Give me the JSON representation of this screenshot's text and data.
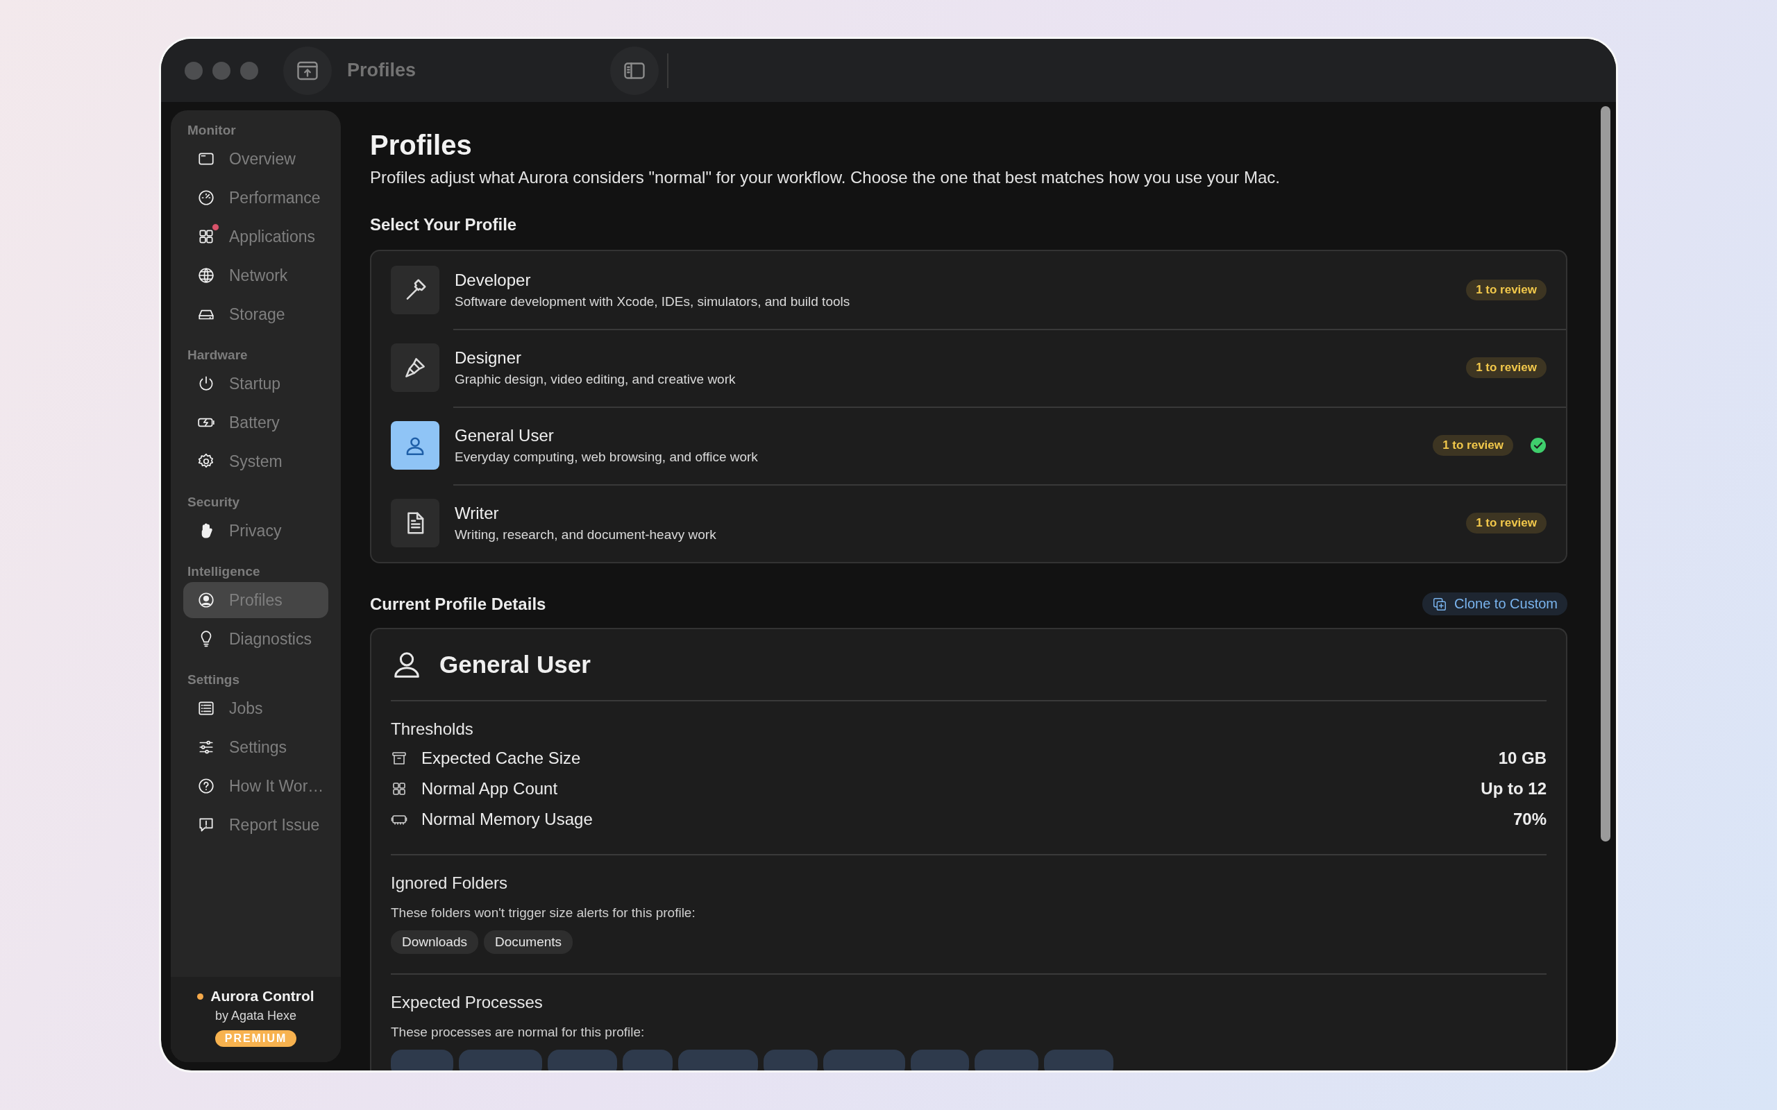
{
  "window": {
    "title": "Profiles"
  },
  "sidebar": {
    "sections": [
      {
        "title": "Monitor",
        "items": [
          {
            "label": "Overview",
            "selected": false,
            "alert": false
          },
          {
            "label": "Performance",
            "selected": false,
            "alert": false
          },
          {
            "label": "Applications",
            "selected": false,
            "alert": true
          },
          {
            "label": "Network",
            "selected": false,
            "alert": false
          },
          {
            "label": "Storage",
            "selected": false,
            "alert": false
          }
        ]
      },
      {
        "title": "Hardware",
        "items": [
          {
            "label": "Startup",
            "selected": false,
            "alert": false
          },
          {
            "label": "Battery",
            "selected": false,
            "alert": false
          },
          {
            "label": "System",
            "selected": false,
            "alert": false
          }
        ]
      },
      {
        "title": "Security",
        "items": [
          {
            "label": "Privacy",
            "selected": false,
            "alert": false
          }
        ]
      },
      {
        "title": "Intelligence",
        "items": [
          {
            "label": "Profiles",
            "selected": true,
            "alert": false
          },
          {
            "label": "Diagnostics",
            "selected": false,
            "alert": false
          }
        ]
      },
      {
        "title": "Settings",
        "items": [
          {
            "label": "Jobs",
            "selected": false,
            "alert": false
          },
          {
            "label": "Settings",
            "selected": false,
            "alert": false
          },
          {
            "label": "How It Wor…",
            "selected": false,
            "alert": false
          },
          {
            "label": "Report Issue",
            "selected": false,
            "alert": false
          }
        ]
      }
    ],
    "footer": {
      "app": "Aurora Control",
      "author": "by Agata Hexe",
      "badge": "PREMIUM"
    }
  },
  "page": {
    "title": "Profiles",
    "description": "Profiles adjust what Aurora considers \"normal\" for your workflow. Choose the one that best matches how you use your Mac."
  },
  "select_heading": "Select Your Profile",
  "profiles": [
    {
      "name": "Developer",
      "description": "Software development with Xcode, IDEs, simulators, and build tools",
      "review": "1 to review",
      "selected": false
    },
    {
      "name": "Designer",
      "description": "Graphic design, video editing, and creative work",
      "review": "1 to review",
      "selected": false
    },
    {
      "name": "General User",
      "description": "Everyday computing, web browsing, and office work",
      "review": "1 to review",
      "selected": true
    },
    {
      "name": "Writer",
      "description": "Writing, research, and document-heavy work",
      "review": "1 to review",
      "selected": false
    }
  ],
  "details": {
    "heading": "Current Profile Details",
    "clone_button": "Clone to Custom",
    "name": "General User",
    "thresholds": {
      "title": "Thresholds",
      "rows": [
        {
          "label": "Expected Cache Size",
          "value": "10 GB"
        },
        {
          "label": "Normal App Count",
          "value": "Up to 12"
        },
        {
          "label": "Normal Memory Usage",
          "value": "70%"
        }
      ]
    },
    "ignored_folders": {
      "title": "Ignored Folders",
      "subtitle": "These folders won't trigger size alerts for this profile:",
      "tags": [
        "Downloads",
        "Documents"
      ]
    },
    "expected_processes": {
      "title": "Expected Processes",
      "subtitle": "These processes are normal for this profile:"
    }
  }
}
